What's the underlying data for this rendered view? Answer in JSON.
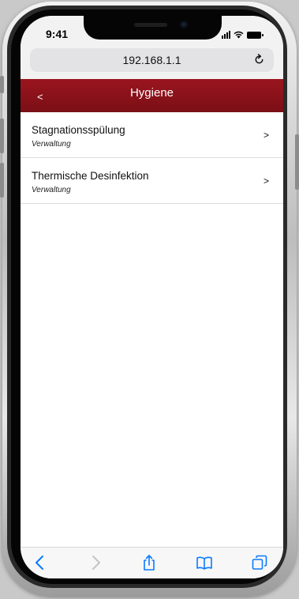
{
  "status_bar": {
    "time": "9:41",
    "icons": [
      "signal-icon",
      "wifi-icon",
      "battery-icon"
    ]
  },
  "browser": {
    "url": "192.168.1.1",
    "reload_icon": "reload-icon",
    "toolbar": [
      "back-icon",
      "forward-icon",
      "share-icon",
      "bookmarks-icon",
      "tabs-icon"
    ],
    "accent_color": "#0a7aff"
  },
  "header": {
    "back_label": "<",
    "title": "Hygiene",
    "color": "#8b121a"
  },
  "items": [
    {
      "title": "Stagnationsspülung",
      "subtitle": "Verwaltung",
      "chevron": ">"
    },
    {
      "title": "Thermische Desinfektion",
      "subtitle": "Verwaltung",
      "chevron": ">"
    }
  ]
}
